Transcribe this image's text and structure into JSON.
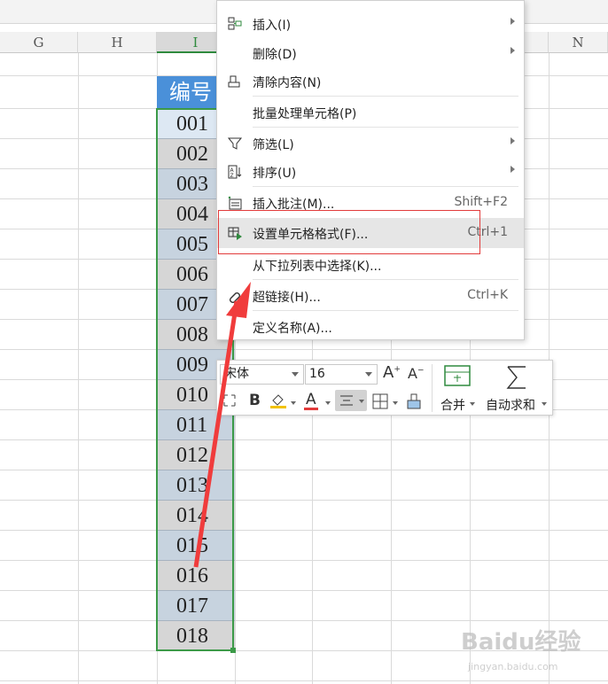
{
  "columns": {
    "g": "G",
    "h": "H",
    "i": "I",
    "n": "N"
  },
  "header_cell": "编号",
  "cells": [
    "001",
    "002",
    "003",
    "004",
    "005",
    "006",
    "007",
    "008",
    "009",
    "010",
    "011",
    "012",
    "013",
    "014",
    "015",
    "016",
    "017",
    "018"
  ],
  "context_menu": {
    "insert": "插入(I)",
    "delete": "删除(D)",
    "clear_contents": "清除内容(N)",
    "batch_process": "批量处理单元格(P)",
    "filter": "筛选(L)",
    "sort": "排序(U)",
    "insert_comment": "插入批注(M)...",
    "insert_comment_shortcut": "Shift+F2",
    "format_cells": "设置单元格格式(F)...",
    "format_cells_shortcut": "Ctrl+1",
    "pick_from_list": "从下拉列表中选择(K)...",
    "hyperlink": "超链接(H)...",
    "hyperlink_shortcut": "Ctrl+K",
    "define_name": "定义名称(A)..."
  },
  "mini_toolbar": {
    "font_name": "宋体",
    "font_size": "16",
    "merge_label": "合并",
    "autosum_label": "自动求和"
  },
  "watermark": {
    "logo": "Baidu经验",
    "url": "jingyan.baidu.com"
  },
  "colors": {
    "header_fill": "#4a90d9",
    "selection_border": "#3c9a48",
    "highlight_box": "#e23b3b",
    "arrow": "#f03c3c"
  }
}
